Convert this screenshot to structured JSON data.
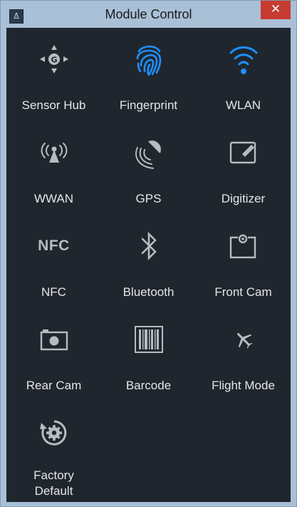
{
  "window": {
    "title": "Module Control",
    "close_glyph": "✕",
    "app_icon_glyph": "♙"
  },
  "colors": {
    "title_bar": "#a9c0d6",
    "background": "#1f262e",
    "icon_inactive": "#b8bcc2",
    "icon_active": "#1e90ff",
    "text": "#e6e6e6",
    "close_button": "#c73b31"
  },
  "modules": [
    {
      "label": "Sensor Hub",
      "icon": "sensor-hub-icon",
      "active": false
    },
    {
      "label": "Fingerprint",
      "icon": "fingerprint-icon",
      "active": true
    },
    {
      "label": "WLAN",
      "icon": "wifi-icon",
      "active": true
    },
    {
      "label": "WWAN",
      "icon": "antenna-icon",
      "active": false
    },
    {
      "label": "GPS",
      "icon": "satellite-dish-icon",
      "active": false
    },
    {
      "label": "Digitizer",
      "icon": "pen-tablet-icon",
      "active": false
    },
    {
      "label": "NFC",
      "icon": "nfc-icon",
      "icon_text": "NFC",
      "active": false
    },
    {
      "label": "Bluetooth",
      "icon": "bluetooth-icon",
      "active": false
    },
    {
      "label": "Front Cam",
      "icon": "front-camera-icon",
      "active": false
    },
    {
      "label": "Rear Cam",
      "icon": "rear-camera-icon",
      "active": false
    },
    {
      "label": "Barcode",
      "icon": "barcode-icon",
      "active": false
    },
    {
      "label": "Flight Mode",
      "icon": "airplane-icon",
      "active": false
    },
    {
      "label": "Factory\nDefault",
      "icon": "factory-reset-icon",
      "active": false
    }
  ]
}
